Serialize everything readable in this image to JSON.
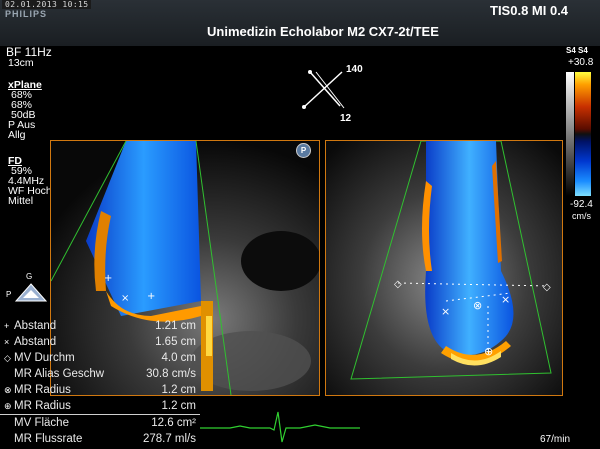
{
  "header": {
    "date": "02.01.2013 10:15",
    "brand": "PHILIPS",
    "tis_mi": "TIS0.8  MI 0.4",
    "title": "Unimedizin Echolabor M2    CX7-2t/TEE"
  },
  "left_panel": {
    "bf": "BF 11Hz",
    "depth": "13cm",
    "xplane_title": "xPlane",
    "xplane_values": [
      "68%",
      "68%",
      "50dB",
      "P Aus",
      "Allg"
    ],
    "fd_title": "FD",
    "fd_values": [
      "59%",
      "4.4MHz",
      "WF Hoch",
      "Mittel"
    ]
  },
  "orientation": {
    "angle_top": "140",
    "angle_bottom": "12",
    "probe_marker": "P",
    "g_label": "G",
    "p_label": "P"
  },
  "scale": {
    "label": "S4 S4",
    "max": "+30.8",
    "min": "-92.4",
    "unit": "cm/s"
  },
  "measurements": [
    {
      "icon": "+",
      "label": "Abstand",
      "value": "1.21 cm"
    },
    {
      "icon": "×",
      "label": "Abstand",
      "value": "1.65 cm"
    },
    {
      "icon": "◇",
      "label": "MV Durchm",
      "value": "4.0 cm"
    },
    {
      "icon": "",
      "label": "MR Alias Geschw",
      "value": "30.8 cm/s"
    },
    {
      "icon": "⊗",
      "label": "MR Radius",
      "value": "1.2 cm"
    },
    {
      "icon": "⊕",
      "label": "MR Radius",
      "value": "1.2 cm"
    },
    {
      "icon": "",
      "label": "MV Fläche",
      "value": "12.6 cm²"
    },
    {
      "icon": "",
      "label": "MR Flussrate",
      "value": "278.7 ml/s"
    }
  ],
  "heart_rate": "67/min",
  "colors": {
    "panel_border": "#d07810",
    "doppler_blue": "#1a8cff",
    "doppler_orange": "#ffa000",
    "ecg": "#30d030"
  }
}
